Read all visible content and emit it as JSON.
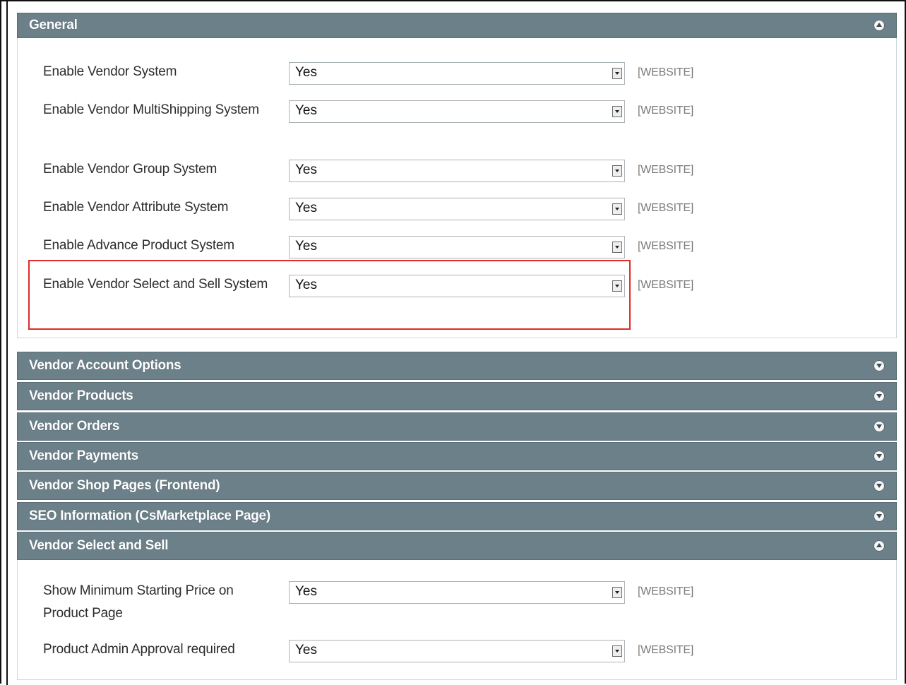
{
  "general": {
    "title": "General",
    "rows": [
      {
        "label": "Enable Vendor System",
        "value": "Yes",
        "scope": "[WEBSITE]"
      },
      {
        "label": "Enable Vendor MultiShipping System",
        "value": "Yes",
        "scope": "[WEBSITE]"
      },
      {
        "label": "Enable Vendor Group System",
        "value": "Yes",
        "scope": "[WEBSITE]"
      },
      {
        "label": "Enable Vendor Attribute System",
        "value": "Yes",
        "scope": "[WEBSITE]"
      },
      {
        "label": "Enable Advance Product System",
        "value": "Yes",
        "scope": "[WEBSITE]"
      },
      {
        "label": "Enable Vendor Select and Sell System",
        "value": "Yes",
        "scope": "[WEBSITE]"
      }
    ]
  },
  "collapsed_sections": [
    "Vendor Account Options",
    "Vendor Products",
    "Vendor Orders",
    "Vendor Payments",
    "Vendor Shop Pages (Frontend)",
    "SEO Information (CsMarketplace Page)"
  ],
  "select_sell": {
    "title": "Vendor Select and Sell",
    "rows": [
      {
        "label": "Show Minimum Starting Price on Product Page",
        "value": "Yes",
        "scope": "[WEBSITE]"
      },
      {
        "label": "Product Admin Approval required",
        "value": "Yes",
        "scope": "[WEBSITE]"
      }
    ]
  },
  "icons": {
    "expanded": "chevron-up-icon",
    "collapsed": "chevron-down-icon"
  },
  "colors": {
    "header_bg": "#6c8089",
    "highlight": "#e02b2b"
  }
}
